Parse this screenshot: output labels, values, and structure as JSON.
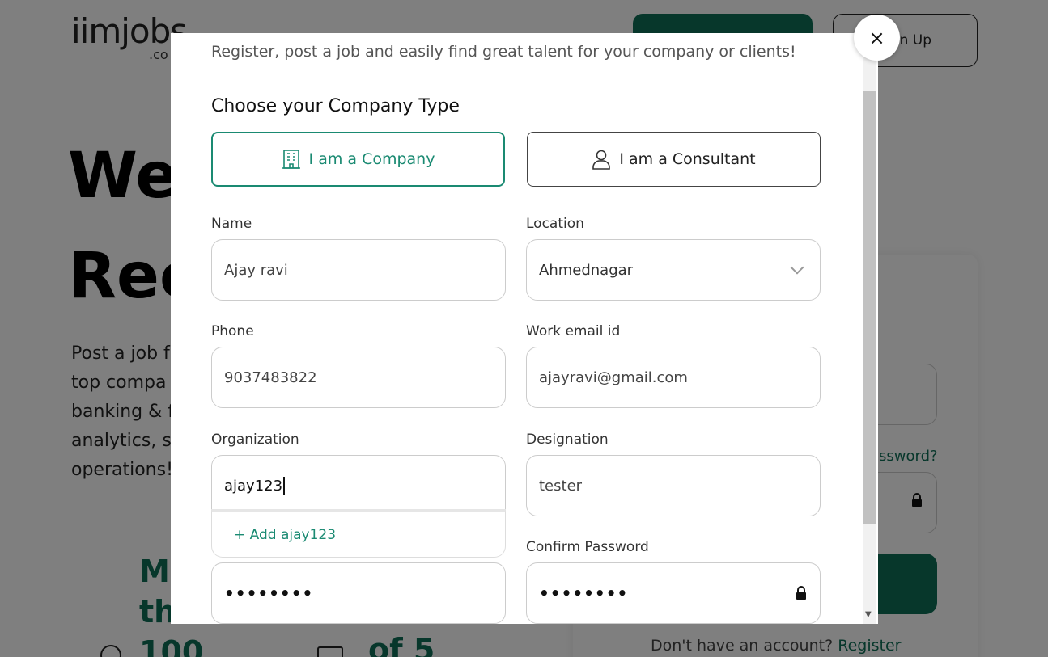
{
  "background": {
    "logo": "iimjobs",
    "logo_sub": ".co",
    "signup_label": "n Up",
    "hero_title_line1": "We",
    "hero_title_line2": "Rec",
    "hero_desc": "Post a job f\ntop compa\nbanking & f\nanalytics, s\noperations!",
    "stats_line1": "Mo",
    "stats_line2": "tha",
    "stats_line3": "100",
    "stats_b": "of 5",
    "forgot_label": "ssword?",
    "no_account": "Don't have an account?",
    "register_link": "Register"
  },
  "modal": {
    "subtitle": "Register, post a job and easily find great talent for your company or clients!",
    "section_title": "Choose your Company Type",
    "company_type": {
      "company_label": "I am a Company",
      "consultant_label": "I am a Consultant",
      "selected": "company"
    },
    "fields": {
      "name_label": "Name",
      "name_value": "Ajay ravi",
      "location_label": "Location",
      "location_value": "Ahmednagar",
      "phone_label": "Phone",
      "phone_value": "9037483822",
      "email_label": "Work email id",
      "email_value": "ajayravi@gmail.com",
      "organization_label": "Organization",
      "organization_value": "ajay123",
      "designation_label": "Designation",
      "designation_value": "tester",
      "password_value": "••••••••",
      "confirm_password_label": "Confirm Password",
      "confirm_password_value": "••••••••"
    },
    "suggestion": "+ Add ajay123",
    "close_icon": "×"
  },
  "colors": {
    "brand": "#0f6e57",
    "accent": "#1a8a72"
  }
}
